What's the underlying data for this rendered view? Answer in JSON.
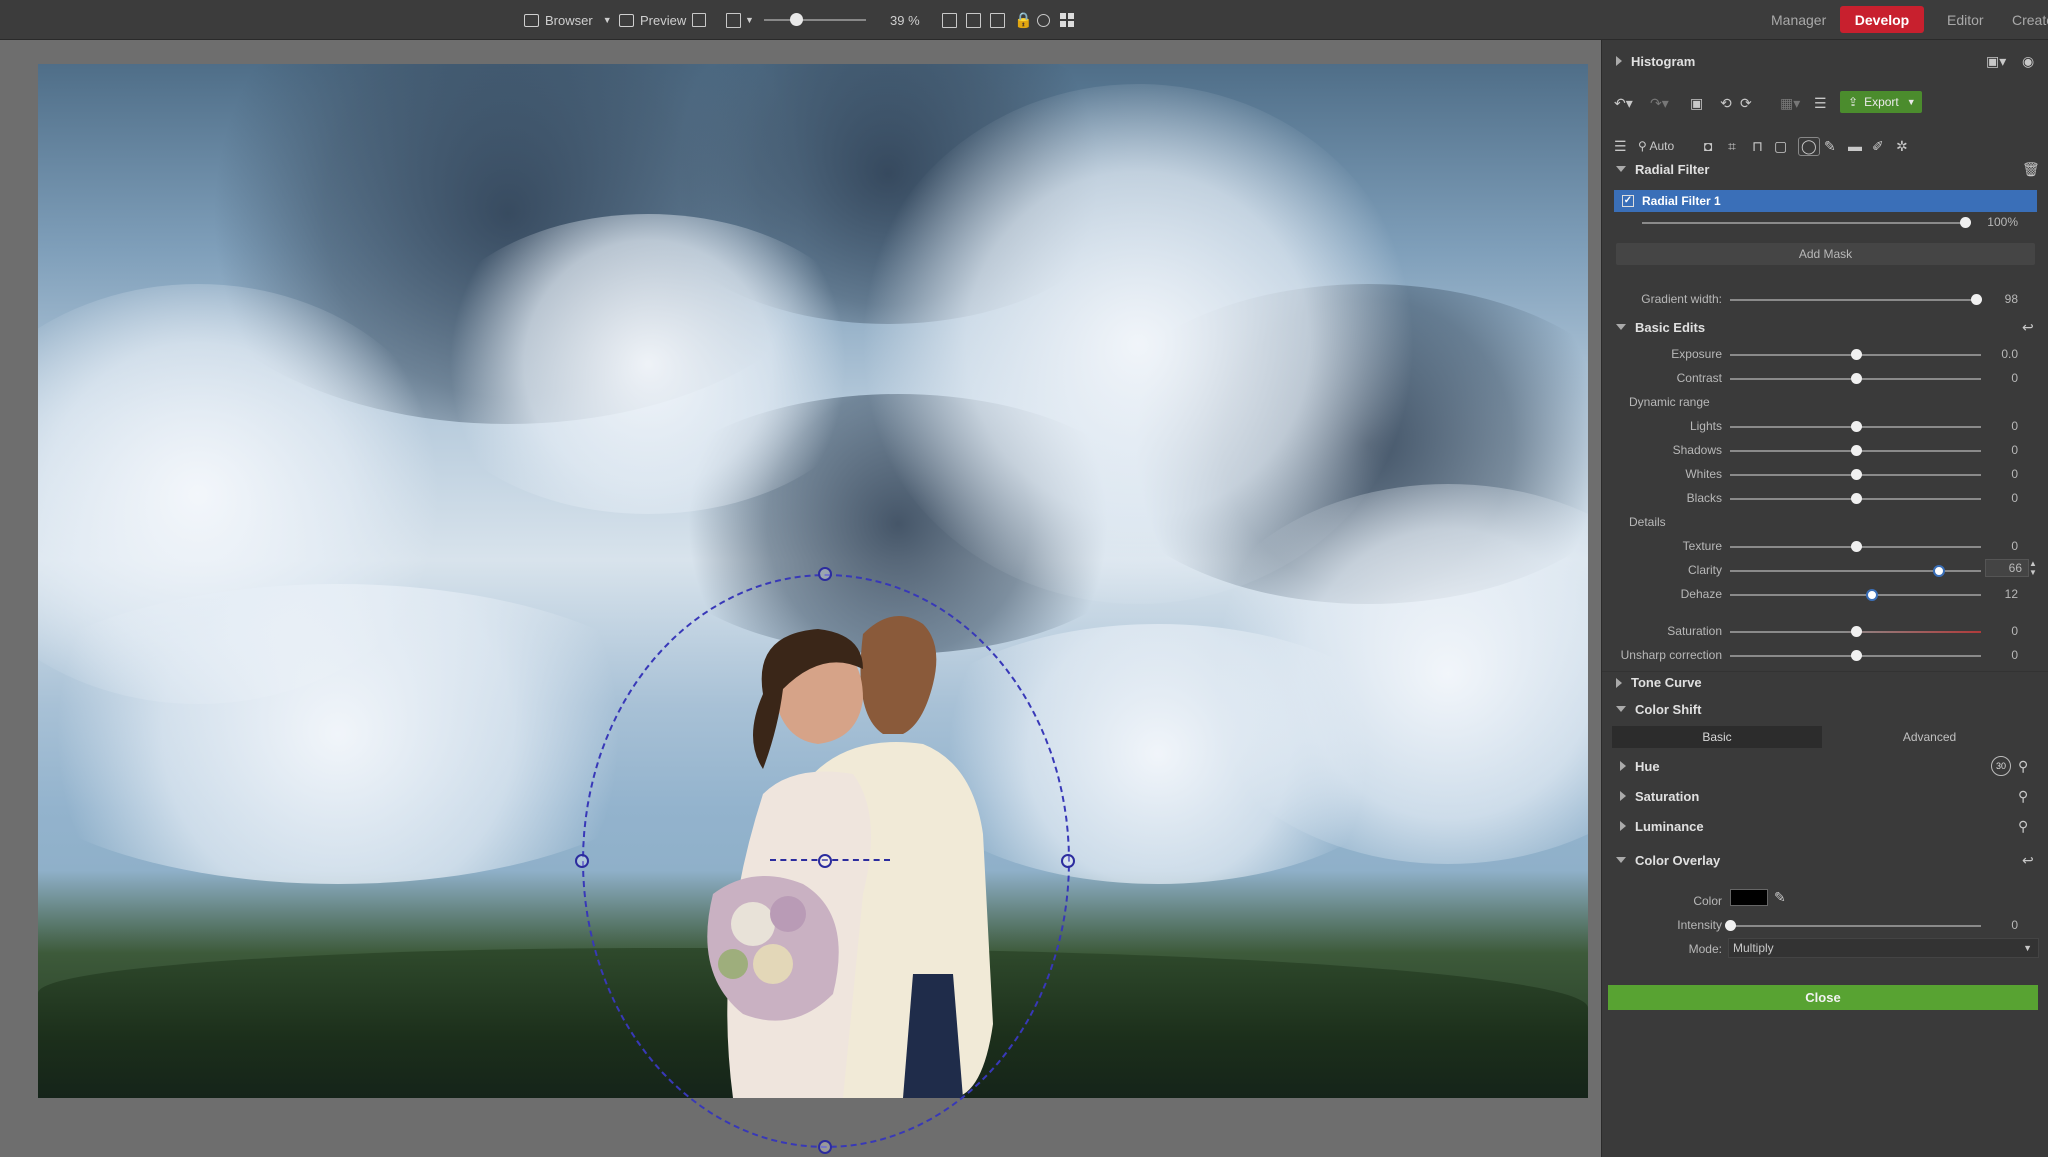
{
  "toolbar": {
    "browser_label": "Browser",
    "preview_label": "Preview",
    "zoom_value": "39 %",
    "zoom_fraction": 0.25,
    "modes": [
      {
        "label": "Manager",
        "active": false
      },
      {
        "label": "Develop",
        "active": true
      },
      {
        "label": "Editor",
        "active": false
      },
      {
        "label": "Create",
        "active": false
      }
    ]
  },
  "panel": {
    "histogram_title": "Histogram",
    "export_label": "Export",
    "auto_label": "Auto",
    "radial_filter": {
      "title": "Radial Filter",
      "item_label": "Radial Filter 1",
      "item_checked": true,
      "opacity_value": "100%",
      "opacity_fraction": 1.0,
      "add_mask_label": "Add Mask",
      "gradient_label": "Gradient width:",
      "gradient_value": "98",
      "gradient_fraction": 0.98
    },
    "basic_edits": {
      "title": "Basic Edits",
      "exposure": {
        "label": "Exposure",
        "value": "0.0",
        "fraction": 0.5
      },
      "contrast": {
        "label": "Contrast",
        "value": "0",
        "fraction": 0.5
      },
      "dynamic_range_label": "Dynamic range",
      "lights": {
        "label": "Lights",
        "value": "0",
        "fraction": 0.5
      },
      "shadows": {
        "label": "Shadows",
        "value": "0",
        "fraction": 0.5
      },
      "whites": {
        "label": "Whites",
        "value": "0",
        "fraction": 0.5
      },
      "blacks": {
        "label": "Blacks",
        "value": "0",
        "fraction": 0.5
      },
      "details_label": "Details",
      "texture": {
        "label": "Texture",
        "value": "0",
        "fraction": 0.5
      },
      "clarity": {
        "label": "Clarity",
        "value": "66",
        "fraction": 0.83
      },
      "dehaze": {
        "label": "Dehaze",
        "value": "12",
        "fraction": 0.56
      },
      "saturation": {
        "label": "Saturation",
        "value": "0",
        "fraction": 0.5
      },
      "unsharp": {
        "label": "Unsharp correction",
        "value": "0",
        "fraction": 0.5
      }
    },
    "tone_curve_title": "Tone Curve",
    "color_shift": {
      "title": "Color Shift",
      "tab_basic": "Basic",
      "tab_advanced": "Advanced",
      "hue_label": "Hue",
      "hue_badge": "30",
      "saturation_label": "Saturation",
      "luminance_label": "Luminance"
    },
    "color_overlay": {
      "title": "Color Overlay",
      "color_label": "Color",
      "swatch_color": "#000000",
      "intensity_label": "Intensity",
      "intensity_value": "0",
      "intensity_fraction": 0.0,
      "mode_label": "Mode:",
      "mode_value": "Multiply"
    },
    "close_label": "Close"
  },
  "colors": {
    "accent_red": "#c8202e",
    "selection_blue": "#3a6fb8",
    "close_green": "#58a332",
    "export_green": "#4b8c2d"
  }
}
